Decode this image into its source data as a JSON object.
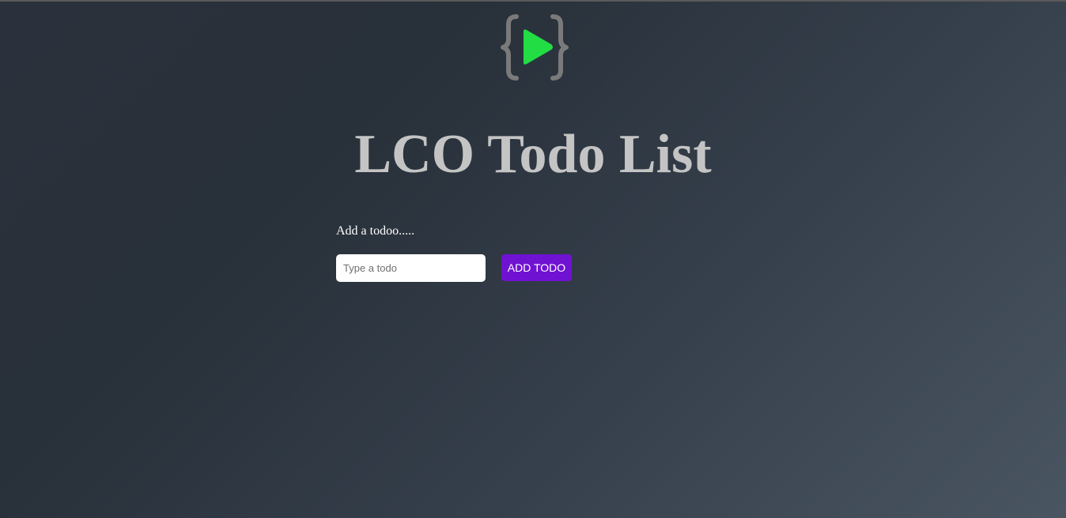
{
  "header": {
    "title": "LCO Todo List",
    "logo_icon": "code-play-icon"
  },
  "form": {
    "label": "Add a todoo.....",
    "input_value": "",
    "input_placeholder": "Type a todo",
    "add_button_label": "ADD TODO"
  },
  "colors": {
    "brace": "#7a7a7a",
    "play": "#22dd44",
    "button": "#7012d1",
    "title": "#c4c4c4"
  }
}
